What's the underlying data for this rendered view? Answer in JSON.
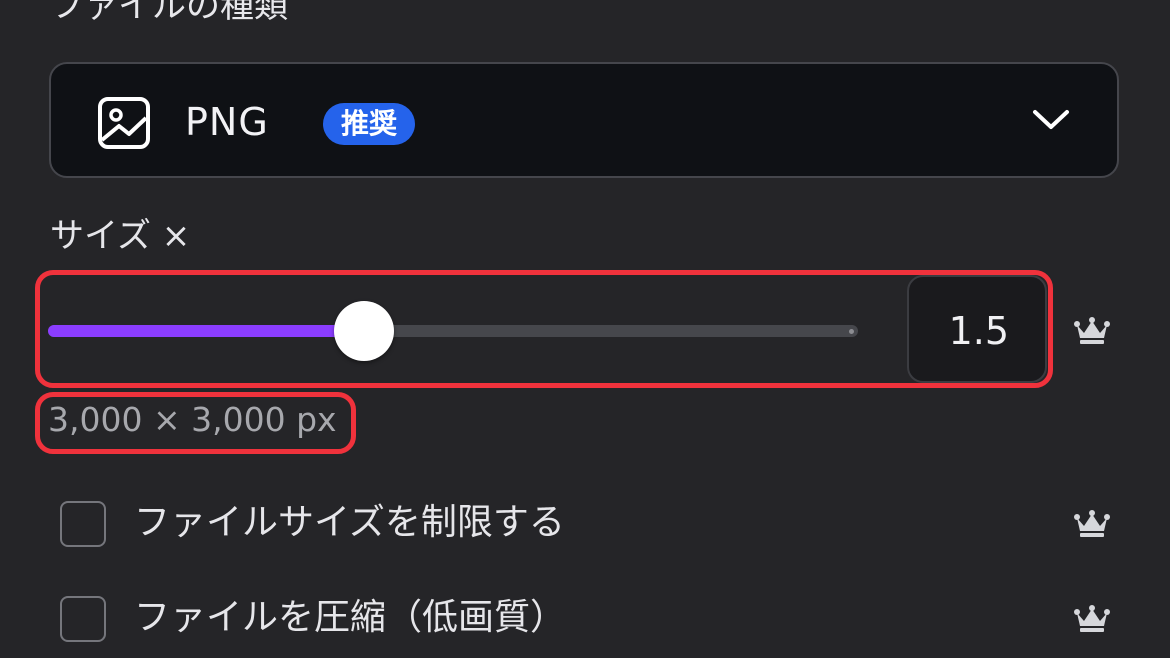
{
  "file_type_section": {
    "title": "ファイルの種類",
    "selected": "PNG",
    "badge": "推奨",
    "icon": "image-icon"
  },
  "size": {
    "label": "サイズ ×",
    "value": "1.5",
    "slider_fraction": 0.39,
    "dimensions": "3,000 × 3,000 px",
    "premium_icon": "crown-icon"
  },
  "options": [
    {
      "label": "ファイルサイズを制限する",
      "checked": false,
      "premium": true
    },
    {
      "label": "ファイルを圧縮（低画質）",
      "checked": false,
      "premium": true
    }
  ],
  "colors": {
    "accent_purple": "#8b3dff",
    "badge_blue": "#2563eb",
    "highlight_red": "#f0323c",
    "background": "#252528"
  }
}
